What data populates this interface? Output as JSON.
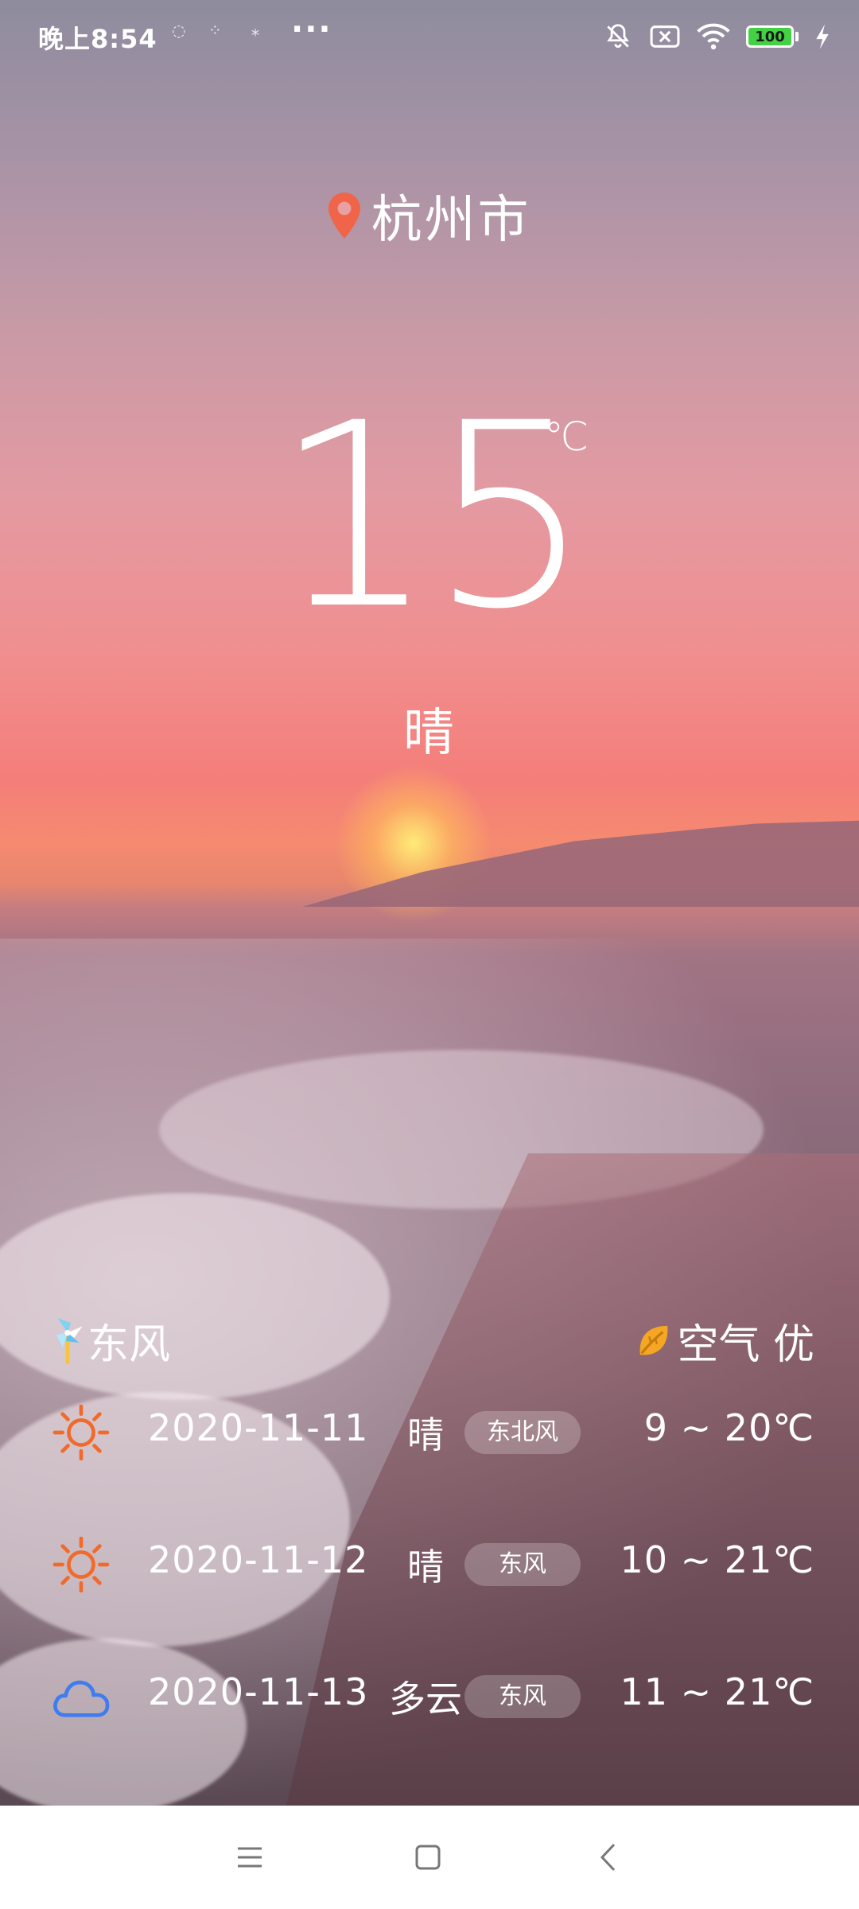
{
  "status_bar": {
    "time": "晚上8:54",
    "dots": "···",
    "battery_level": "100"
  },
  "location": {
    "city": "杭州市",
    "icon": "location-pin-icon"
  },
  "current": {
    "temperature": "15",
    "unit": "℃",
    "condition": "晴"
  },
  "wind": {
    "label": "东风",
    "icon": "windmill-icon"
  },
  "air": {
    "label": "空气 优",
    "icon": "leaf-icon"
  },
  "forecast": [
    {
      "date": "2020-11-11",
      "weather": "晴",
      "wind": "东北风",
      "temp": "9 ~ 20℃",
      "icon": "sun-icon"
    },
    {
      "date": "2020-11-12",
      "weather": "晴",
      "wind": "东风",
      "temp": "10 ~ 21℃",
      "icon": "sun-icon"
    },
    {
      "date": "2020-11-13",
      "weather": "多云",
      "wind": "东风",
      "temp": "11 ~ 21℃",
      "icon": "cloud-icon"
    }
  ],
  "colors": {
    "sun": "#f26a2a",
    "cloud": "#3f7cf0",
    "pin": "#f0654a",
    "leaf": "#f5a623",
    "battery": "#45d146"
  }
}
